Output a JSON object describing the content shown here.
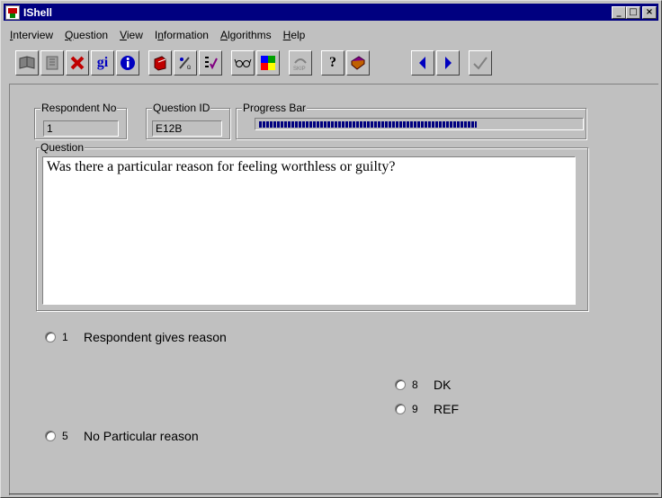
{
  "window": {
    "title": "IShell",
    "minimize": "_",
    "maximize": "□",
    "close": "×"
  },
  "menu": [
    {
      "label": "Interview",
      "accel": "I",
      "rest": "nterview"
    },
    {
      "label": "Question",
      "accel": "Q",
      "rest": "uestion"
    },
    {
      "label": "View",
      "accel": "V",
      "rest": "iew"
    },
    {
      "label": "Information",
      "accel": "n",
      "pre": "I",
      "rest": "formation"
    },
    {
      "label": "Algorithms",
      "accel": "A",
      "rest": "lgorithms"
    },
    {
      "label": "Help",
      "accel": "H",
      "rest": "elp"
    }
  ],
  "toolbar": {
    "buttons": [
      {
        "icon": "open-book-icon"
      },
      {
        "icon": "book-icon"
      },
      {
        "icon": "red-x-icon"
      },
      {
        "icon": "gi-icon",
        "text": "gi"
      },
      {
        "icon": "info-icon",
        "text": "i"
      },
      {
        "icon": "red-book-icon"
      },
      {
        "icon": "percent-icon"
      },
      {
        "icon": "checklist-icon"
      },
      {
        "icon": "glasses-icon"
      },
      {
        "icon": "color-grid-icon"
      },
      {
        "icon": "skip-icon",
        "text": "SKIP"
      },
      {
        "icon": "help-icon",
        "text": "?"
      },
      {
        "icon": "purple-book-icon"
      },
      {
        "icon": "back-arrow-icon"
      },
      {
        "icon": "forward-arrow-icon"
      },
      {
        "icon": "checkmark-icon"
      }
    ]
  },
  "respondent": {
    "label": "Respondent No",
    "value": "1"
  },
  "question_id": {
    "label": "Question ID",
    "value": "E12B"
  },
  "progress": {
    "label": "Progress Bar",
    "fraction": 0.68
  },
  "question": {
    "label": "Question",
    "text": "Was there a particular reason for feeling worthless or guilty?"
  },
  "options": [
    {
      "code": "1",
      "text": "Respondent gives reason"
    },
    {
      "code": "8",
      "text": "DK"
    },
    {
      "code": "9",
      "text": "REF"
    },
    {
      "code": "5",
      "text": "No Particular reason"
    }
  ],
  "colors": {
    "titlebar": "#000080",
    "face": "#c0c0c0",
    "progress": "#000080"
  }
}
